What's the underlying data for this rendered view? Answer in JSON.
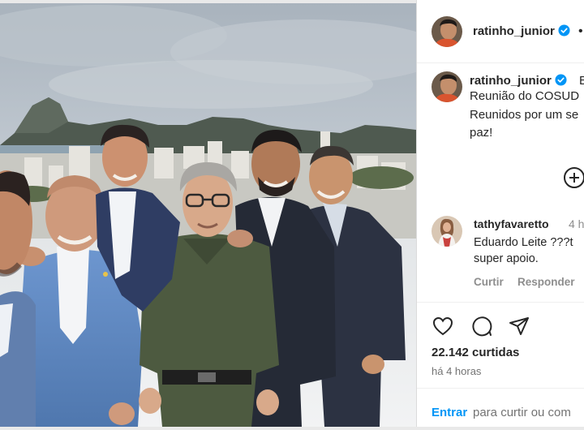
{
  "post": {
    "author": "ratinho_junior",
    "header_more": "•••",
    "photo_alt": "group-photo"
  },
  "caption": {
    "author": "ratinho_junior",
    "edited_fragment": "E",
    "lines": [
      "Reunião do COSUD",
      "Reunidos por um se",
      "paz!"
    ]
  },
  "comment": {
    "author": "tathyfavaretto",
    "time": "4 h",
    "lines": [
      "Eduardo Leite ???t",
      "super apoio."
    ],
    "like_action": "Curtir",
    "reply_action": "Responder"
  },
  "stats": {
    "likes": "22.142 curtidas",
    "time_ago": "há 4 horas"
  },
  "footer": {
    "login_link": "Entrar",
    "login_rest": "para curtir ou com"
  },
  "colors": {
    "verified": "#0095f6",
    "link": "#0095f6",
    "text": "#262626",
    "muted": "#8e8e8e",
    "divider": "#efefef"
  }
}
